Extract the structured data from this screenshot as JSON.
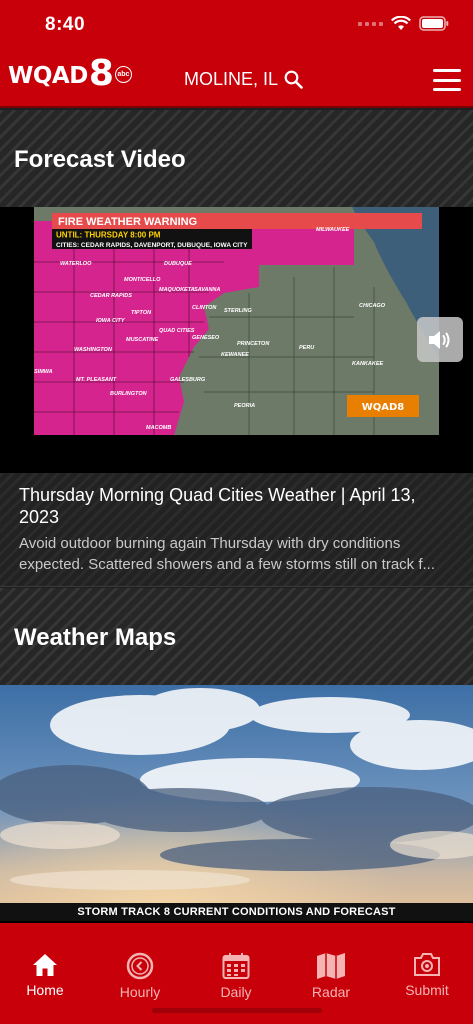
{
  "status_bar": {
    "time": "8:40"
  },
  "header": {
    "logo_text": "WQAD",
    "logo_number": "8",
    "logo_network": "abc",
    "location": "MOLINE, IL"
  },
  "forecast_video": {
    "section_title": "Forecast Video",
    "video_overlay": {
      "warning_title": "FIRE WEATHER WARNING",
      "until": "UNTIL: THURSDAY 8:00 PM",
      "cities": "CITIES: CEDAR RAPIDS, DAVENPORT, DUBUQUE, IOWA CITY",
      "station_bug": "WQAD8",
      "map_labels": [
        "MILWAUKEE",
        "WATERLOO",
        "DUBUQUE",
        "MONTICELLO",
        "CEDAR RAPIDS",
        "MAQUOKETA",
        "SAVANNA",
        "TIPTON",
        "CLINTON",
        "STERLING",
        "IOWA CITY",
        "QUAD CITIES",
        "GENESEO",
        "MUSCATINE",
        "KEWANEE",
        "PRINCETON",
        "PERU",
        "WASHINGTON",
        "CHICAGO",
        "SIMWA",
        "MT. PLEASANT",
        "GALESBURG",
        "KANKAKEE",
        "BURLINGTON",
        "PEORIA",
        "MACOMB"
      ]
    },
    "article": {
      "title": "Thursday Morning Quad Cities Weather | April 13, 2023",
      "description": "Avoid outdoor burning again Thursday with dry conditions expected. Scattered showers and a few storms still on track f..."
    }
  },
  "weather_maps": {
    "section_title": "Weather Maps",
    "image_caption": "STORM TRACK 8 CURRENT CONDITIONS AND FORECAST"
  },
  "tab_bar": {
    "tabs": [
      {
        "label": "Home",
        "icon": "home-icon",
        "active": true
      },
      {
        "label": "Hourly",
        "icon": "clock-icon",
        "active": false
      },
      {
        "label": "Daily",
        "icon": "calendar-icon",
        "active": false
      },
      {
        "label": "Radar",
        "icon": "map-icon",
        "active": false
      },
      {
        "label": "Submit",
        "icon": "camera-icon",
        "active": false
      }
    ]
  },
  "colors": {
    "brand_red": "#c8000a",
    "warning_magenta": "#d6248f",
    "tab_inactive": "#f5b3b3"
  }
}
